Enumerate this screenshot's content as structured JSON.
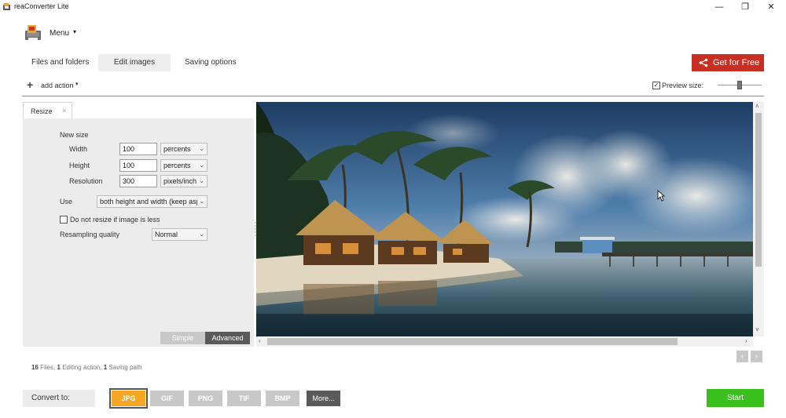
{
  "window": {
    "title": "reaConverter Lite",
    "minimize_glyph": "—",
    "restore_glyph": "❐",
    "close_glyph": "✕"
  },
  "menu": {
    "label": "Menu",
    "caret": "▾"
  },
  "tabs": [
    {
      "label": "Files and folders",
      "selected": false
    },
    {
      "label": "Edit images",
      "selected": true
    },
    {
      "label": "Saving options",
      "selected": false
    }
  ],
  "get_free": {
    "label": "Get for Free",
    "color": "#c62f22"
  },
  "actions": {
    "add_plus": "+",
    "add_label": "add action",
    "caret": "▾"
  },
  "preview_size": {
    "checkbox_glyph": "✓",
    "checked": true,
    "label": "Preview size:",
    "level": 0.5
  },
  "resize_tab": {
    "label": "Resize",
    "close_glyph": "×"
  },
  "resize": {
    "new_size_label": "New size",
    "width": {
      "label": "Width",
      "value": "100",
      "unit": "percents"
    },
    "height": {
      "label": "Height",
      "value": "100",
      "unit": "percents"
    },
    "resolution": {
      "label": "Resolution",
      "value": "300",
      "unit": "pixels/inch"
    },
    "use": {
      "label": "Use",
      "value": "both height and width (keep asp"
    },
    "no_resize": {
      "label": "Do not resize if image is less",
      "checked": false
    },
    "resampling": {
      "label": "Resampling quality",
      "value": "Normal"
    },
    "dropdown_chevron": "⌄"
  },
  "mode": {
    "simple": "Simple",
    "advanced": "Advanced",
    "selected": "Advanced"
  },
  "scroll": {
    "up": "˄",
    "down": "˅",
    "left": "‹",
    "right": "›"
  },
  "nav": {
    "prev": "‹",
    "next": "›"
  },
  "status": {
    "files_count": "16",
    "files_label": "Files,",
    "editing_count": "1",
    "editing_label": "Editing action,",
    "saving_count": "1",
    "saving_label": "Saving path"
  },
  "convert": {
    "label": "Convert to:",
    "formats": [
      "JPG",
      "GIF",
      "PNG",
      "TIF",
      "BMP"
    ],
    "selected": "JPG",
    "more_label": "More...",
    "selected_color": "#f5a623"
  },
  "start": {
    "label": "Start",
    "color": "#3ac01d"
  }
}
